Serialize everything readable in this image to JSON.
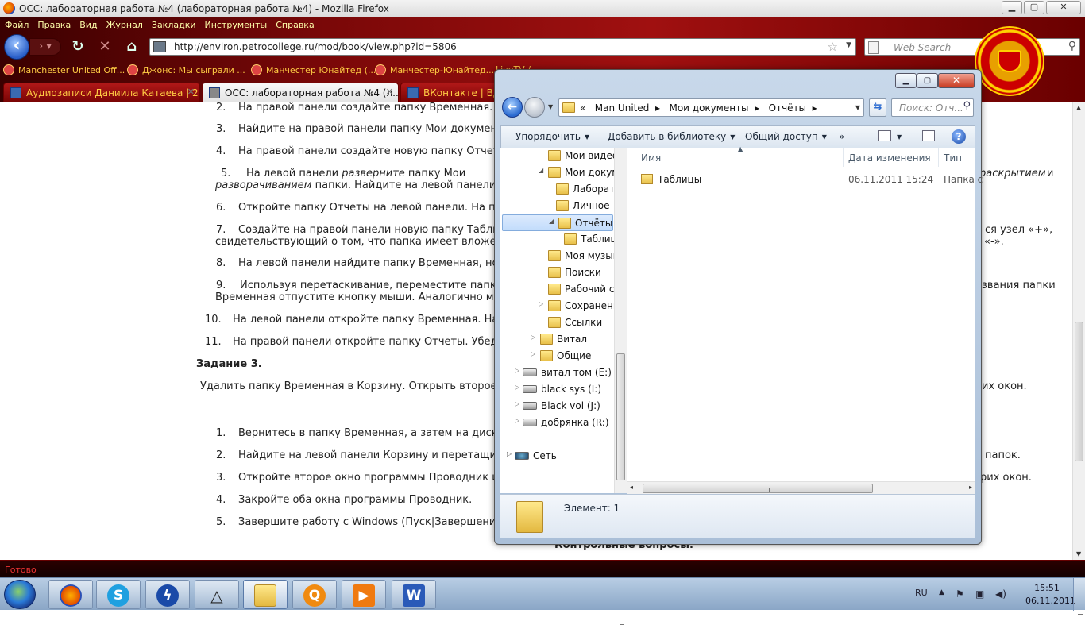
{
  "firefox": {
    "window_title": "ОСС: лабораторная работа №4 (лабораторная работа №4) - Mozilla Firefox",
    "menu": [
      "Файл",
      "Правка",
      "Вид",
      "Журнал",
      "Закладки",
      "Инструменты",
      "Справка"
    ],
    "url": "http://environ.petrocollege.ru/mod/book/view.php?id=5806",
    "search_placeholder": "Web Search",
    "bookmarks": [
      "Manchester United Off...",
      "Джонс: Мы сыграли ...",
      "Манчестер Юнайтед (...",
      "Манчестер-Юнайтед...",
      "LiveTV / ...."
    ],
    "tabs": [
      "Аудиозаписи Даниила Катаева | 22...",
      "ОСС: лабораторная работа №4 (л...",
      "ВКонтакте | Вдре..."
    ],
    "status": "Готово"
  },
  "page": {
    "lines": [
      {
        "num": "2.",
        "text": "На правой панели создайте папку Временная."
      },
      {
        "num": "3.",
        "text": "Найдите на правой панели папку Мои документ"
      },
      {
        "num": "4.",
        "text": "На правой панели создайте новую папку Отчет"
      },
      {
        "num": "5.",
        "pre": "На левой панели ",
        "em": "разверните",
        "post": " папку Мои"
      },
      {
        "text_em": "разворачиванием",
        "post": " папки. Найдите на левой панели"
      },
      {
        "num": "6.",
        "text": "Откройте папку Отчеты на левой панели. На пр"
      },
      {
        "num": "7.",
        "text": "Создайте на правой панели новую папку Табли"
      },
      {
        "text": "свидетельствующий о том, что папка имеет вложе"
      },
      {
        "num": "8.",
        "text": "На левой панели найдите папку Временная, но"
      },
      {
        "num": "9.",
        "text": "Используя перетаскивание, переместите папк"
      },
      {
        "text": "Временная отпустите кнопку мыши. Аналогично мож"
      },
      {
        "num": "10.",
        "text": "На левой панели откройте папку Временная. На"
      },
      {
        "num": "11.",
        "text": "На правой панели откройте папку Отчеты. Убеди"
      },
      {
        "heading": "Задание 3."
      },
      {
        "text": "Удалить папку Временная в Корзину. Открыть второе о"
      },
      {
        "num": "1.",
        "text": "Вернитесь в папку Временная, а затем  на диск"
      },
      {
        "num": "2.",
        "text": "Найдите на левой панели Корзину и перетащит"
      },
      {
        "num": "3.",
        "text": "Откройте второе окно программы Проводник и"
      },
      {
        "num": "4.",
        "text": "Закройте оба окна программы Проводник."
      },
      {
        "num": "5.",
        "text": "Завершите работу с Windows (Пуск|Завершение"
      }
    ],
    "right_fragments": [
      "раскрытием",
      "и",
      "ся узел «+»,",
      "«-».",
      "звания папки",
      "их окон.",
      "папок.",
      "рих окон.",
      "Контрольные вопросы."
    ]
  },
  "explorer": {
    "breadcrumb": [
      "«",
      "Man United",
      "▸",
      "Мои документы",
      "▸",
      "Отчёты",
      "▸"
    ],
    "search_placeholder": "Поиск: Отч...",
    "toolbar": [
      "Упорядочить",
      "Добавить в библиотеку",
      "Общий доступ",
      "»"
    ],
    "nav": [
      {
        "label": "Мои видео"
      },
      {
        "label": "Мои документы"
      },
      {
        "label": "Лабораторные"
      },
      {
        "label": "Личное"
      },
      {
        "label": "Отчёты"
      },
      {
        "label": "Таблицы"
      },
      {
        "label": "Моя музыка"
      },
      {
        "label": "Поиски"
      },
      {
        "label": "Рабочий стол"
      },
      {
        "label": "Сохраненные"
      },
      {
        "label": "Ссылки"
      },
      {
        "label": "Витал"
      },
      {
        "label": "Общие"
      },
      {
        "label": "витал том (E:)"
      },
      {
        "label": "black sys (I:)"
      },
      {
        "label": "Black vol (J:)"
      },
      {
        "label": "добрянка (R:)"
      },
      {
        "label": "Сеть"
      }
    ],
    "columns": [
      "Имя",
      "Дата изменения",
      "Тип"
    ],
    "files": [
      {
        "name": "Таблицы",
        "date": "06.11.2011 15:24",
        "type": "Папка с"
      }
    ],
    "details": "Элемент: 1"
  },
  "taskbar": {
    "lang": "RU",
    "time": "15:51",
    "date": "06.11.2011"
  }
}
